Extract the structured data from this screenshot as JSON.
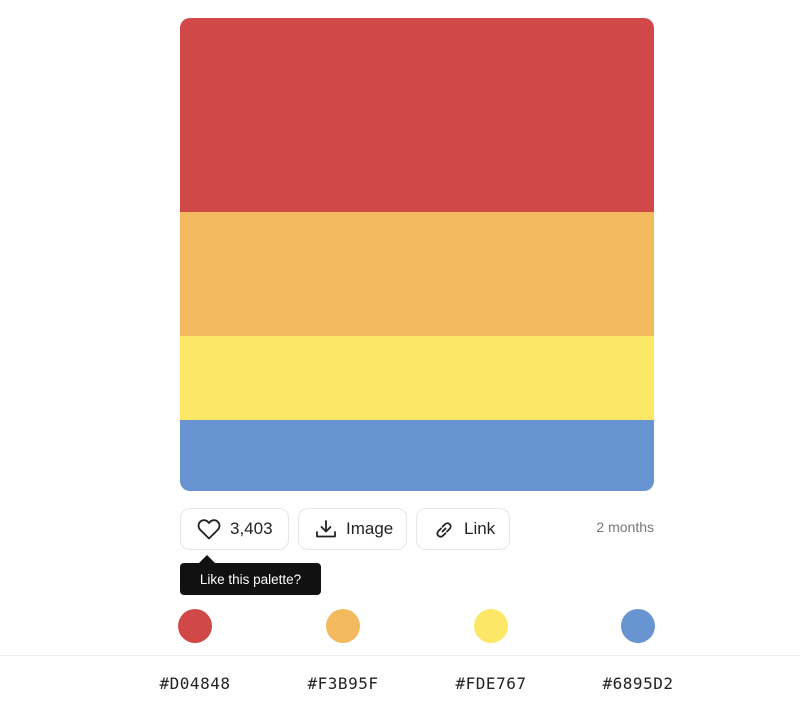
{
  "palette": {
    "colors": [
      {
        "hex": "#D04848",
        "label": "#D04848"
      },
      {
        "hex": "#F3B95F",
        "label": "#F3B95F"
      },
      {
        "hex": "#FDE767",
        "label": "#FDE767"
      },
      {
        "hex": "#6895D2",
        "label": "#6895D2"
      }
    ]
  },
  "actions": {
    "likes": "3,403",
    "image_label": "Image",
    "link_label": "Link",
    "time_ago": "2 months"
  },
  "tooltip": {
    "text": "Like this palette?"
  },
  "icons": {
    "like": "heart-icon",
    "image": "download-icon",
    "link": "link-icon"
  }
}
